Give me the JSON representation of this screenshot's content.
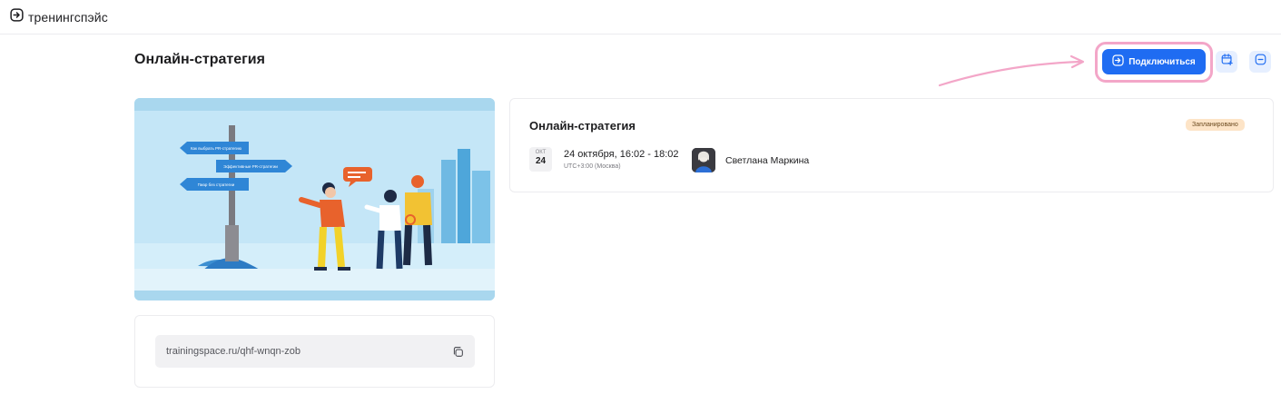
{
  "brand": {
    "name": "тренингспэйс"
  },
  "page": {
    "title": "Онлайн-стратегия"
  },
  "actions": {
    "connect_label": "Подключиться",
    "calendar_icon": "calendar-add-icon",
    "leave_icon": "minus-circle-icon"
  },
  "cover": {
    "signs": [
      "Как выбрать PR-стратегию",
      "Эффективные PR-стратегии",
      "Пиар без стратегии"
    ]
  },
  "link": {
    "url": "trainingspace.ru/qhf-wnqn-zob"
  },
  "session": {
    "title": "Онлайн-стратегия",
    "status": "Запланировано",
    "date_month": "ОКТ",
    "date_day": "24",
    "date_text": "24 октября, 16:02 - 18:02",
    "timezone": "UTC+3:00 (Москва)",
    "speaker": "Светлана Маркина"
  },
  "colors": {
    "accent": "#1f6cf2",
    "highlight": "#f3a6c8",
    "status_bg": "#fde4c7"
  }
}
